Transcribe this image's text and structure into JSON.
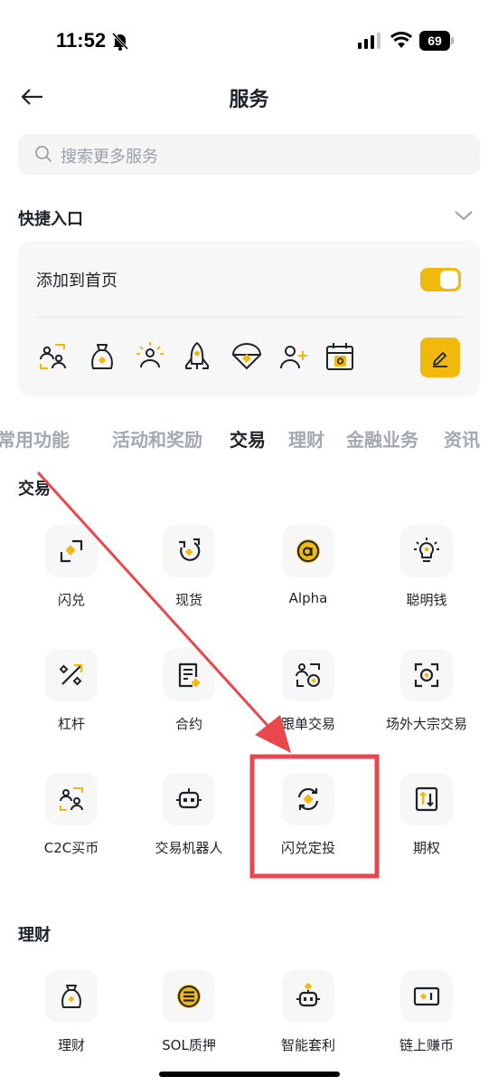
{
  "status_bar": {
    "time": "11:52",
    "battery": "69"
  },
  "header": {
    "title": "服务"
  },
  "search": {
    "placeholder": "搜索更多服务"
  },
  "quick_entry": {
    "title": "快捷入口",
    "add_to_home_label": "添加到首页",
    "toggle_on": true,
    "icons": [
      "c2c-icon",
      "earn-bag-icon",
      "sunny-user-icon",
      "rocket-icon",
      "parachute-icon",
      "add-user-icon",
      "calendar-alpha-icon"
    ]
  },
  "tabs": [
    "常用功能",
    "活动和奖励",
    "交易",
    "理财",
    "金融业务",
    "资讯"
  ],
  "active_tab": "交易",
  "trade_section": {
    "title": "交易",
    "items": [
      {
        "label": "闪兑",
        "icon": "convert-icon"
      },
      {
        "label": "现货",
        "icon": "spot-icon"
      },
      {
        "label": "Alpha",
        "icon": "alpha-icon"
      },
      {
        "label": "聪明钱",
        "icon": "smart-money-icon"
      },
      {
        "label": "杠杆",
        "icon": "margin-icon"
      },
      {
        "label": "合约",
        "icon": "futures-icon"
      },
      {
        "label": "跟单交易",
        "icon": "copy-trading-icon"
      },
      {
        "label": "场外大宗交易",
        "icon": "otc-icon"
      },
      {
        "label": "C2C买币",
        "icon": "c2c-icon"
      },
      {
        "label": "交易机器人",
        "icon": "trading-bot-icon"
      },
      {
        "label": "闪兑定投",
        "icon": "recurring-convert-icon"
      },
      {
        "label": "期权",
        "icon": "options-icon"
      }
    ]
  },
  "earn_section": {
    "title": "理财",
    "items": [
      {
        "label": "理财",
        "icon": "earn-bag-icon"
      },
      {
        "label": "SOL质押",
        "icon": "sol-staking-icon"
      },
      {
        "label": "智能套利",
        "icon": "smart-arbitrage-icon"
      },
      {
        "label": "链上赚币",
        "icon": "onchain-earn-icon"
      }
    ]
  },
  "colors": {
    "accent": "#f0b90b",
    "annotation": "#e8484c",
    "text": "#1e2329",
    "muted": "#a3a9b1"
  }
}
